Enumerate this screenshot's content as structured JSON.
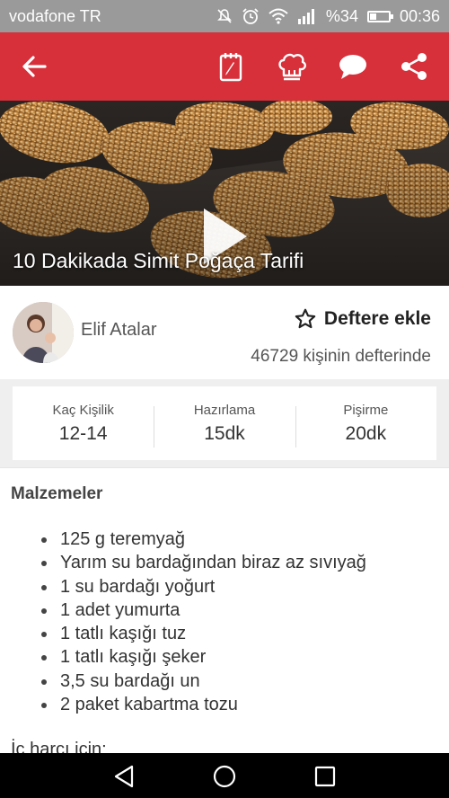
{
  "status_bar": {
    "carrier": "vodafone TR",
    "battery_text": "%34",
    "battery_level": 0.34,
    "time": "00:36",
    "icons": [
      "mute-icon",
      "alarm-icon",
      "wifi-icon",
      "signal-icon",
      "battery-icon"
    ]
  },
  "app_bar": {
    "icons": [
      "back-arrow-icon",
      "notebook-icon",
      "chef-hat-icon",
      "chat-icon",
      "share-icon"
    ],
    "color": "#d7303a"
  },
  "recipe": {
    "title": "10 Dakikada Simit Poğaça Tarifi",
    "video_icon": "play-icon"
  },
  "author": {
    "name": "Elif Atalar",
    "add_label": "Deftere ekle",
    "notebook_count": "46729 kişinin defterinde"
  },
  "stats": [
    {
      "label": "Kaç Kişilik",
      "value": "12-14"
    },
    {
      "label": "Hazırlama",
      "value": "15dk"
    },
    {
      "label": "Pişirme",
      "value": "20dk"
    }
  ],
  "ingredients": {
    "title": "Malzemeler",
    "items": [
      "125 g teremyağ",
      "Yarım su bardağından biraz az sıvıyağ",
      "1 su bardağı yoğurt",
      "1 adet yumurta",
      "1 tatlı kaşığı tuz",
      "1 tatlı kaşığı şeker",
      "3,5 su bardağı un",
      "2 paket kabartma tozu"
    ],
    "next_section": "İç harcı için:"
  },
  "nav_bar": {
    "icons": [
      "nav-back-icon",
      "nav-home-icon",
      "nav-recents-icon"
    ]
  }
}
